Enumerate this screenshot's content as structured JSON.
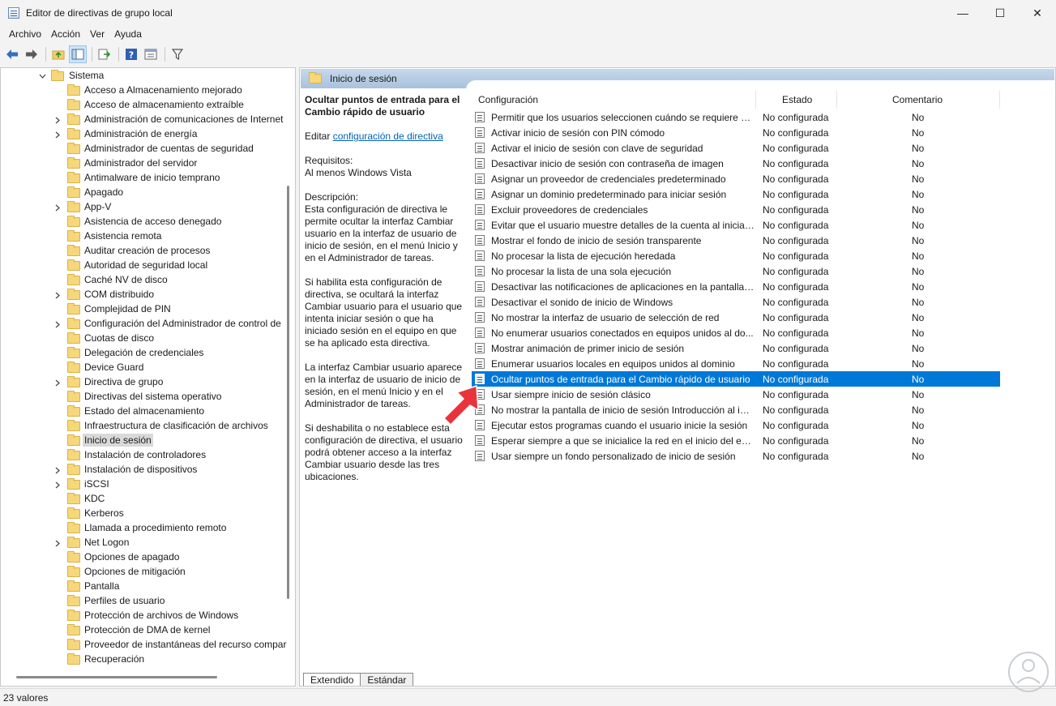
{
  "window": {
    "title": "Editor de directivas de grupo local",
    "controls": {
      "minimize": "—",
      "maximize": "☐",
      "close": "✕"
    }
  },
  "menu": [
    "Archivo",
    "Acción",
    "Ver",
    "Ayuda"
  ],
  "toolbar": {
    "icons": [
      "back-icon",
      "forward-icon",
      "up-folder-icon",
      "show-hide-tree-icon",
      "export-list-icon",
      "help-icon",
      "properties-icon",
      "filter-icon"
    ]
  },
  "tree": {
    "parent": "Sistema",
    "items": [
      {
        "label": "Acceso a Almacenamiento mejorado",
        "expandable": false
      },
      {
        "label": "Acceso de almacenamiento extraíble",
        "expandable": false
      },
      {
        "label": "Administración de comunicaciones de Internet",
        "expandable": true
      },
      {
        "label": "Administración de energía",
        "expandable": true
      },
      {
        "label": "Administrador de cuentas de seguridad",
        "expandable": false
      },
      {
        "label": "Administrador del servidor",
        "expandable": false
      },
      {
        "label": "Antimalware de inicio temprano",
        "expandable": false
      },
      {
        "label": "Apagado",
        "expandable": false
      },
      {
        "label": "App-V",
        "expandable": true
      },
      {
        "label": "Asistencia de acceso denegado",
        "expandable": false
      },
      {
        "label": "Asistencia remota",
        "expandable": false
      },
      {
        "label": "Auditar creación de procesos",
        "expandable": false
      },
      {
        "label": "Autoridad de seguridad local",
        "expandable": false
      },
      {
        "label": "Caché NV de disco",
        "expandable": false
      },
      {
        "label": "COM distribuido",
        "expandable": true
      },
      {
        "label": "Complejidad de PIN",
        "expandable": false
      },
      {
        "label": "Configuración del Administrador de control de",
        "expandable": true
      },
      {
        "label": "Cuotas de disco",
        "expandable": false
      },
      {
        "label": "Delegación de credenciales",
        "expandable": false
      },
      {
        "label": "Device Guard",
        "expandable": false
      },
      {
        "label": "Directiva de grupo",
        "expandable": true
      },
      {
        "label": "Directivas del sistema operativo",
        "expandable": false
      },
      {
        "label": "Estado del almacenamiento",
        "expandable": false
      },
      {
        "label": "Infraestructura de clasificación de archivos",
        "expandable": false
      },
      {
        "label": "Inicio de sesión",
        "expandable": false,
        "selected": true
      },
      {
        "label": "Instalación de controladores",
        "expandable": false
      },
      {
        "label": "Instalación de dispositivos",
        "expandable": true
      },
      {
        "label": "iSCSI",
        "expandable": true
      },
      {
        "label": "KDC",
        "expandable": false
      },
      {
        "label": "Kerberos",
        "expandable": false
      },
      {
        "label": "Llamada a procedimiento remoto",
        "expandable": false
      },
      {
        "label": "Net Logon",
        "expandable": true
      },
      {
        "label": "Opciones de apagado",
        "expandable": false
      },
      {
        "label": "Opciones de mitigación",
        "expandable": false
      },
      {
        "label": "Pantalla",
        "expandable": false
      },
      {
        "label": "Perfiles de usuario",
        "expandable": false
      },
      {
        "label": "Protección de archivos de Windows",
        "expandable": false
      },
      {
        "label": "Protección de DMA de kernel",
        "expandable": false
      },
      {
        "label": "Proveedor de instantáneas del recurso compar",
        "expandable": false
      },
      {
        "label": "Recuperación",
        "expandable": false
      }
    ]
  },
  "right": {
    "header": "Inicio de sesión",
    "description": {
      "title": "Ocultar puntos de entrada para el Cambio rápido de usuario",
      "edit_prefix": "Editar ",
      "edit_link": "configuración de directiva",
      "requirements": "Requisitos:\nAl menos Windows Vista",
      "description_label": "Descripción:",
      "p1": "Esta configuración de directiva le permite ocultar la interfaz Cambiar usuario en la interfaz de usuario de inicio de sesión, en el menú Inicio y en el Administrador de tareas.",
      "p2": "Si habilita esta configuración de directiva, se ocultará la interfaz Cambiar usuario para el usuario que intenta iniciar sesión o que ha iniciado sesión en el equipo en que se ha aplicado esta directiva.",
      "p3": "La interfaz Cambiar usuario aparece en la interfaz de usuario de inicio de sesión, en el menú Inicio y en el Administrador de tareas.",
      "p4": "Si deshabilita o no establece esta configuración de directiva, el usuario podrá obtener acceso a la interfaz Cambiar usuario desde las tres ubicaciones."
    },
    "columns": {
      "name": "Configuración",
      "state": "Estado",
      "comment": "Comentario"
    },
    "rows": [
      {
        "name": "Permitir que los usuarios seleccionen cuándo se requiere un...",
        "state": "No configurada",
        "comment": "No"
      },
      {
        "name": "Activar inicio de sesión con PIN cómodo",
        "state": "No configurada",
        "comment": "No"
      },
      {
        "name": "Activar el inicio de sesión con clave de seguridad",
        "state": "No configurada",
        "comment": "No"
      },
      {
        "name": "Desactivar inicio de sesión con contraseña de imagen",
        "state": "No configurada",
        "comment": "No"
      },
      {
        "name": "Asignar un proveedor de credenciales predeterminado",
        "state": "No configurada",
        "comment": "No"
      },
      {
        "name": "Asignar un dominio predeterminado para iniciar sesión",
        "state": "No configurada",
        "comment": "No"
      },
      {
        "name": "Excluir proveedores de credenciales",
        "state": "No configurada",
        "comment": "No"
      },
      {
        "name": "Evitar que el usuario muestre detalles de la cuenta al iniciar s...",
        "state": "No configurada",
        "comment": "No"
      },
      {
        "name": "Mostrar el fondo de inicio de sesión transparente",
        "state": "No configurada",
        "comment": "No"
      },
      {
        "name": "No procesar la lista de ejecución heredada",
        "state": "No configurada",
        "comment": "No"
      },
      {
        "name": "No procesar la lista de una sola ejecución",
        "state": "No configurada",
        "comment": "No"
      },
      {
        "name": "Desactivar las notificaciones de aplicaciones en la pantalla d...",
        "state": "No configurada",
        "comment": "No"
      },
      {
        "name": "Desactivar el sonido de inicio de Windows",
        "state": "No configurada",
        "comment": "No"
      },
      {
        "name": "No mostrar la interfaz de usuario de selección de red",
        "state": "No configurada",
        "comment": "No"
      },
      {
        "name": "No enumerar usuarios conectados en equipos unidos al do...",
        "state": "No configurada",
        "comment": "No"
      },
      {
        "name": "Mostrar animación de primer inicio de sesión",
        "state": "No configurada",
        "comment": "No"
      },
      {
        "name": "Enumerar usuarios locales en equipos unidos al dominio",
        "state": "No configurada",
        "comment": "No"
      },
      {
        "name": "Ocultar puntos de entrada para el Cambio rápido de usuario",
        "state": "No configurada",
        "comment": "No",
        "selected": true
      },
      {
        "name": "Usar siempre inicio de sesión clásico",
        "state": "No configurada",
        "comment": "No"
      },
      {
        "name": "No mostrar la pantalla de inicio de sesión Introducción al ini...",
        "state": "No configurada",
        "comment": "No"
      },
      {
        "name": "Ejecutar estos programas cuando el usuario inicie la sesión",
        "state": "No configurada",
        "comment": "No"
      },
      {
        "name": "Esperar siempre a que se inicialice la red en el inicio del equi...",
        "state": "No configurada",
        "comment": "No"
      },
      {
        "name": "Usar siempre un fondo personalizado de inicio de sesión",
        "state": "No configurada",
        "comment": "No"
      }
    ],
    "tabs": [
      "Extendido",
      "Estándar"
    ]
  },
  "status": "23 valores",
  "colors": {
    "selection": "#0078d7",
    "arrow": "#e8343a",
    "link": "#0063b1"
  }
}
